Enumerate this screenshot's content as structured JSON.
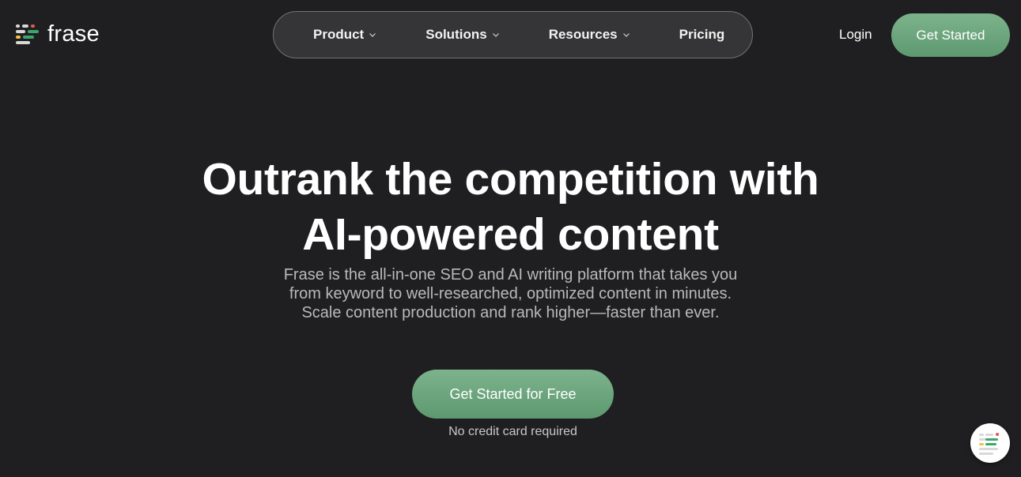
{
  "brand": {
    "name": "frase",
    "logo_icon": "frase-logo-icon",
    "colors": {
      "accent_green": "#6fa77f",
      "background": "#1f1f21",
      "nav_bg": "#353537"
    }
  },
  "nav": {
    "items": [
      {
        "label": "Product",
        "has_dropdown": true
      },
      {
        "label": "Solutions",
        "has_dropdown": true
      },
      {
        "label": "Resources",
        "has_dropdown": true
      },
      {
        "label": "Pricing",
        "has_dropdown": false
      }
    ]
  },
  "header": {
    "login_label": "Login",
    "cta_label": "Get Started"
  },
  "hero": {
    "title_line1": "Outrank the competition with",
    "title_line2": "AI-powered content",
    "subtitle_line1": "Frase is the all-in-one SEO and AI writing platform that takes you",
    "subtitle_line2": "from keyword to well-researched, optimized content in minutes.",
    "subtitle_line3": "Scale content production and rank higher—faster than ever.",
    "cta_label": "Get Started for Free",
    "note": "No credit card required"
  },
  "chat_widget": {
    "icon": "frase-chat-icon"
  }
}
